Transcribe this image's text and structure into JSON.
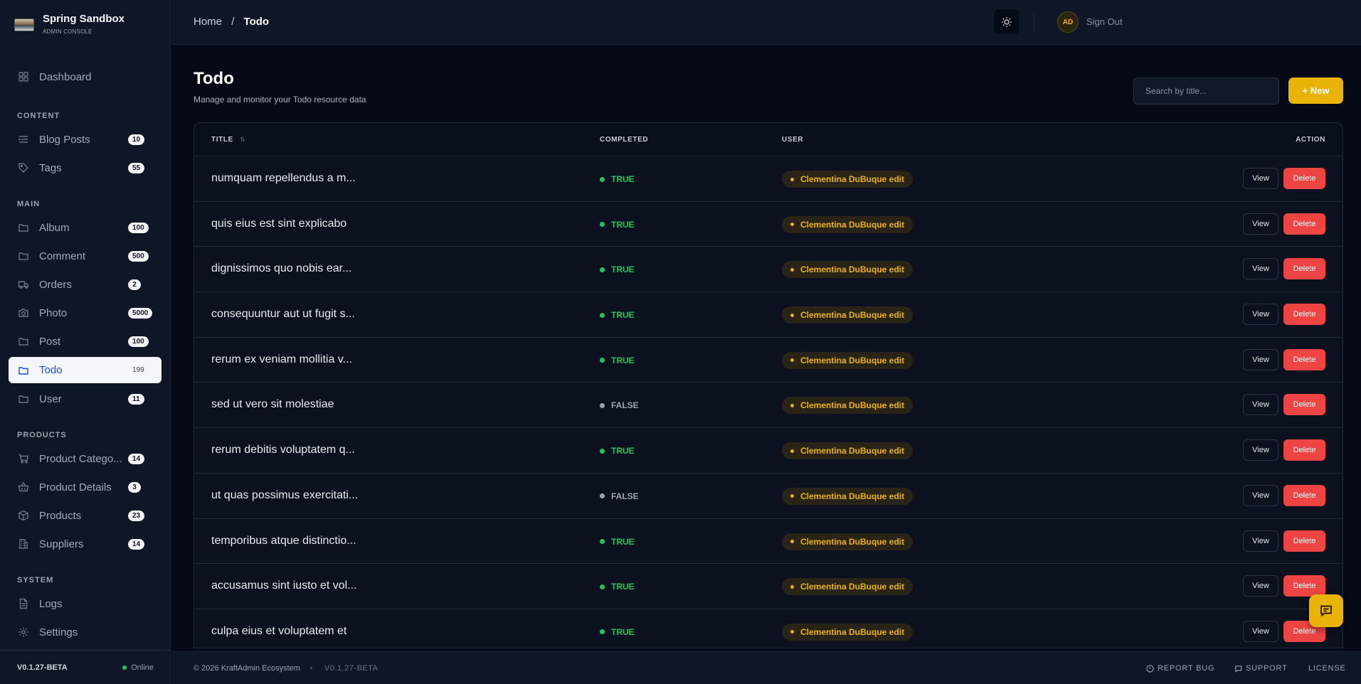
{
  "brand": {
    "title": "Spring Sandbox",
    "subtitle": "ADMIN CONSOLE"
  },
  "sidebar": {
    "dashboard": {
      "label": "Dashboard",
      "icon": "dashboard-icon"
    },
    "sections": [
      {
        "label": "CONTENT",
        "items": [
          {
            "label": "Blog Posts",
            "count": "10",
            "icon": "list-icon"
          },
          {
            "label": "Tags",
            "count": "55",
            "icon": "tag-icon"
          }
        ]
      },
      {
        "label": "MAIN",
        "items": [
          {
            "label": "Album",
            "count": "100",
            "icon": "folder-icon"
          },
          {
            "label": "Comment",
            "count": "500",
            "icon": "folder-icon"
          },
          {
            "label": "Orders",
            "count": "2",
            "icon": "truck-icon"
          },
          {
            "label": "Photo",
            "count": "5000",
            "icon": "camera-icon"
          },
          {
            "label": "Post",
            "count": "100",
            "icon": "folder-icon"
          },
          {
            "label": "Todo",
            "count": "199",
            "icon": "folder-icon",
            "active": true
          },
          {
            "label": "User",
            "count": "11",
            "icon": "folder-icon"
          }
        ]
      },
      {
        "label": "PRODUCTS",
        "items": [
          {
            "label": "Product Catego...",
            "count": "14",
            "icon": "cart-icon"
          },
          {
            "label": "Product Details",
            "count": "3",
            "icon": "basket-icon"
          },
          {
            "label": "Products",
            "count": "23",
            "icon": "box-icon"
          },
          {
            "label": "Suppliers",
            "count": "14",
            "icon": "building-icon"
          }
        ]
      },
      {
        "label": "SYSTEM",
        "items": [
          {
            "label": "Logs",
            "icon": "file-icon"
          },
          {
            "label": "Settings",
            "icon": "gear-icon"
          }
        ]
      }
    ],
    "footer": {
      "version": "V0.1.27-BETA",
      "status": "Online"
    }
  },
  "topbar": {
    "breadcrumb": {
      "home": "Home",
      "separator": "/",
      "current": "Todo"
    },
    "avatar_initials": "AD",
    "signout_label": "Sign Out"
  },
  "page": {
    "title": "Todo",
    "subtitle": "Manage and monitor your Todo resource data",
    "search_placeholder": "Search by title...",
    "new_label": "+ New"
  },
  "table": {
    "columns": {
      "title": "TITLE",
      "completed": "COMPLETED",
      "user": "USER",
      "action": "ACTION"
    },
    "view_label": "View",
    "delete_label": "Delete",
    "rows": [
      {
        "title": "numquam repellendus a m...",
        "completed": "TRUE",
        "user": "Clementina DuBuque edit"
      },
      {
        "title": "quis eius est sint explicabo",
        "completed": "TRUE",
        "user": "Clementina DuBuque edit"
      },
      {
        "title": "dignissimos quo nobis ear...",
        "completed": "TRUE",
        "user": "Clementina DuBuque edit"
      },
      {
        "title": "consequuntur aut ut fugit s...",
        "completed": "TRUE",
        "user": "Clementina DuBuque edit"
      },
      {
        "title": "rerum ex veniam mollitia v...",
        "completed": "TRUE",
        "user": "Clementina DuBuque edit"
      },
      {
        "title": "sed ut vero sit molestiae",
        "completed": "FALSE",
        "user": "Clementina DuBuque edit"
      },
      {
        "title": "rerum debitis voluptatem q...",
        "completed": "TRUE",
        "user": "Clementina DuBuque edit"
      },
      {
        "title": "ut quas possimus exercitati...",
        "completed": "FALSE",
        "user": "Clementina DuBuque edit"
      },
      {
        "title": "temporibus atque distinctio...",
        "completed": "TRUE",
        "user": "Clementina DuBuque edit"
      },
      {
        "title": "accusamus sint iusto et vol...",
        "completed": "TRUE",
        "user": "Clementina DuBuque edit"
      },
      {
        "title": "culpa eius et voluptatem et",
        "completed": "TRUE",
        "user": "Clementina DuBuque edit"
      }
    ]
  },
  "footer": {
    "copyright": "© 2026 KraftAdmin Ecosystem",
    "version": "V0.1.27-BETA",
    "links": {
      "report_bug": "REPORT BUG",
      "support": "SUPPORT",
      "license": "LICENSE"
    }
  },
  "colors": {
    "accent": "#eab308",
    "danger": "#ef4444",
    "success": "#22c55e",
    "muted": "#9ca3af",
    "background": "#050a16",
    "panel": "#0f1626"
  }
}
